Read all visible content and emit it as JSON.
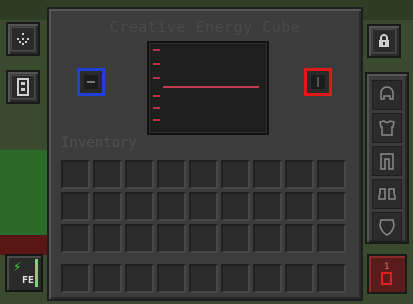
{
  "window": {
    "title": "Creative Energy Cube"
  },
  "inventory": {
    "label": "Inventory"
  },
  "left_buttons": [
    {
      "icon": "config-icon"
    },
    {
      "icon": "side-config-icon"
    }
  ],
  "right_buttons": [
    {
      "icon": "lock-icon"
    }
  ],
  "armor_slots": [
    "helmet-slot",
    "chestplate-slot",
    "leggings-slot",
    "boots-slot",
    "offhand-shield-slot"
  ],
  "energy_display": {
    "fill_fraction": 0.5
  },
  "energy_button": {
    "label": "FE",
    "bolt": "⚡"
  },
  "redstone_button": {
    "count": "1"
  },
  "colors": {
    "input_side": "#1f3fd6",
    "output_side": "#e01818",
    "energy_line": "#c23a4f",
    "energy_bolt": "#3fd23f"
  }
}
